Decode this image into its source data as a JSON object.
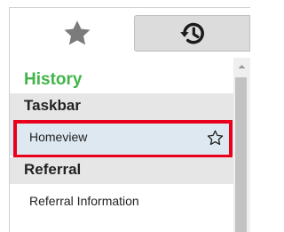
{
  "tabs": [
    {
      "icon": "star-icon",
      "name": "favorites"
    },
    {
      "icon": "history-icon",
      "name": "history"
    }
  ],
  "history_title": "History",
  "groups": [
    {
      "header": "Taskbar",
      "items": [
        {
          "label": "Homeview",
          "selected": true
        }
      ]
    },
    {
      "header": "Referral",
      "items": [
        {
          "label": "Referral Information"
        }
      ]
    }
  ],
  "colors": {
    "history_title": "#41b549",
    "selected_row": "#dde8f1",
    "highlight_box": "#e8001c",
    "group_header_bg": "#e6e6e6",
    "active_tab_bg": "#dcdcdc"
  }
}
